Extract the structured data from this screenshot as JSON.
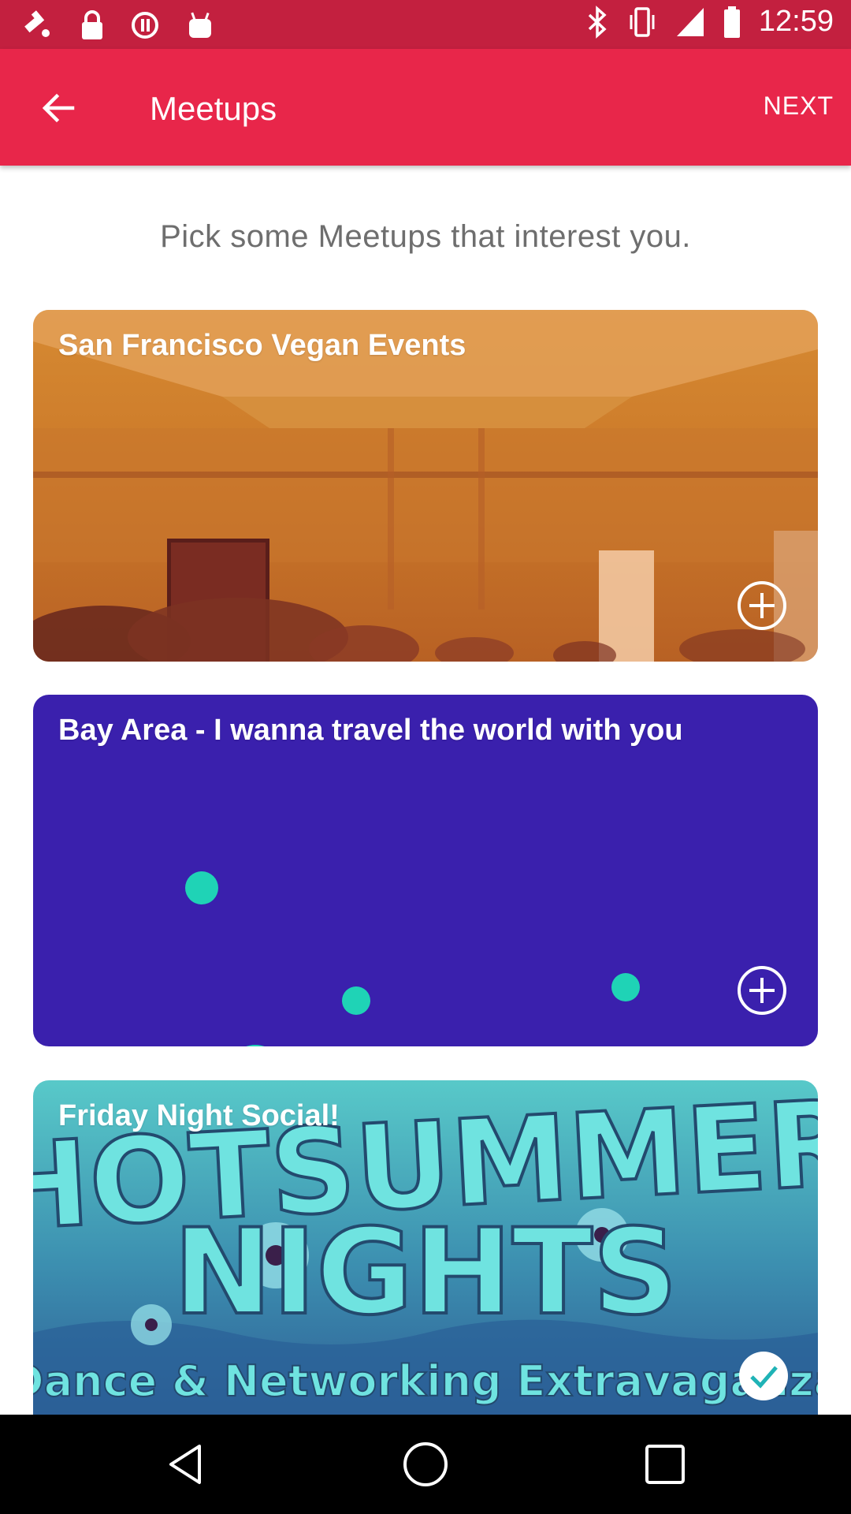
{
  "status_bar": {
    "time": "12:59",
    "icons": [
      "fake-gps-icon",
      "lock-icon",
      "data-saver-icon",
      "android-icon",
      "bluetooth-icon",
      "vibrate-icon",
      "signal-icon",
      "battery-icon"
    ]
  },
  "app_bar": {
    "back_icon": "arrow-back-icon",
    "title": "Meetups",
    "next_label": "NEXT"
  },
  "intro_text": "Pick some Meetups that interest you.",
  "meetups": [
    {
      "name": "San Francisco Vegan Events",
      "selected": false,
      "action_icon": "add-circle-icon"
    },
    {
      "name": "Bay Area - I wanna travel the world with you",
      "selected": false,
      "action_icon": "add-circle-icon"
    },
    {
      "name": "Friday Night Social!",
      "selected": true,
      "action_icon": "check-circle-icon"
    }
  ],
  "card_images": {
    "poster_lines": [
      "HOTSUMMER",
      "NIGHTS",
      "Dance & Networking Extravaganza"
    ]
  },
  "nav_bar": {
    "icons": [
      "nav-back-icon",
      "nav-home-icon",
      "nav-recents-icon"
    ]
  },
  "colors": {
    "status_bar": "#c3203f",
    "app_bar": "#e8264a",
    "card_2": "#3a20ad",
    "dots": "#1fd3b6"
  }
}
